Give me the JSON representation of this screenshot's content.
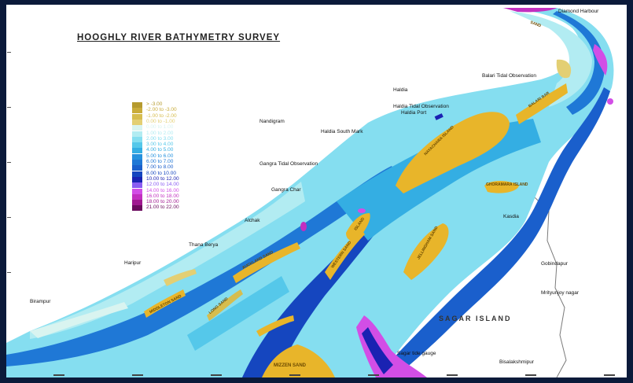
{
  "map": {
    "title": "HOOGHLY RIVER BATHYMETRY SURVEY",
    "region_label": "SAGAR ISLAND"
  },
  "legend": [
    {
      "label": "> -3.00",
      "color": "#b59a2e"
    },
    {
      "label": "-2.00 to -3.00",
      "color": "#c9ac3a"
    },
    {
      "label": "-1.00 to -2.00",
      "color": "#d6bd4e"
    },
    {
      "label": "0.00 to -1.00",
      "color": "#e3cf73"
    },
    {
      "label": "0.00 to 1.00",
      "color": "#d9f4f0"
    },
    {
      "label": "1.00 to 2.00",
      "color": "#b2ecf2"
    },
    {
      "label": "2.00 to 3.00",
      "color": "#85def0"
    },
    {
      "label": "3.00 to 4.00",
      "color": "#55c8ea"
    },
    {
      "label": "4.00 to 5.00",
      "color": "#34aee3"
    },
    {
      "label": "5.00 to 6.00",
      "color": "#2592de"
    },
    {
      "label": "6.00 to 7.00",
      "color": "#1f78d6"
    },
    {
      "label": "7.00 to 8.00",
      "color": "#1a5fcc"
    },
    {
      "label": "8.00 to 10.00",
      "color": "#1546bf"
    },
    {
      "label": "10.00 to 12.00",
      "color": "#1a22b2"
    },
    {
      "label": "12.00 to 14.00",
      "color": "#8a5cf2"
    },
    {
      "label": "14.00 to 16.00",
      "color": "#d24ee6"
    },
    {
      "label": "16.00 to 18.00",
      "color": "#c22fc0"
    },
    {
      "label": "18.00 to 20.00",
      "color": "#a01890"
    },
    {
      "label": "21.00 to 22.00",
      "color": "#6b0a5e"
    }
  ],
  "places": {
    "diamond_harbour": "Diamond Harbour",
    "balari": "Balari Tidal Observation",
    "haldia": "Haldia",
    "haldia_tidal": "Haldia Tidal Observation",
    "haldia_port": "Haldia Port",
    "nandigram": "Nandigram",
    "haldia_south": "Haldia South Mark",
    "gangra_tidal": "Gangra Tidal Observation",
    "gangra_char": "Gangra Char",
    "alchak": "Alchak",
    "thana_berya": "Thana Berya",
    "haripur": "Haripur",
    "birampur": "Birampur",
    "kasdia": "Kasdia",
    "gobindapur": "Gobindapur",
    "mrityunjoy": "Mrityunjoy nagar",
    "sagar_gauge": "Sagar tide gauge",
    "bisalakshmipur": "Bisalakshmipur"
  },
  "shoals": {
    "nayachara": "NAYACHARA ISLAND",
    "balari_bar": "BALARI BAR",
    "ghoramara": "GHORAMARA ISLAND",
    "jellingham": "JELLINGHAM SAND",
    "island": "ISLAND",
    "western_sand": "WESTERN SAND",
    "auckland": "AUCKLAND SAND",
    "middleton": "MIDDLETON SAND",
    "long_sand": "LONG SAND",
    "mizzen_sand": "MIZZEN SAND",
    "sand_top": "SAND"
  }
}
